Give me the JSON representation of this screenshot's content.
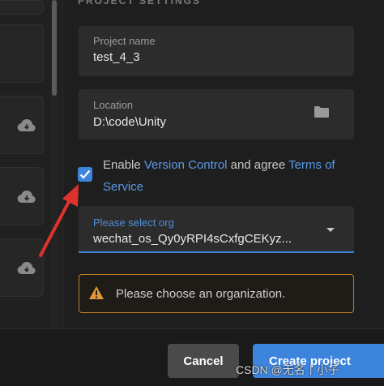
{
  "section": {
    "title": "PROJECT SETTINGS"
  },
  "project_name": {
    "label": "Project name",
    "value": "test_4_3"
  },
  "location": {
    "label": "Location",
    "value": "D:\\code\\Unity",
    "icon": "folder-icon"
  },
  "agreement": {
    "checked": true,
    "prefix": "Enable ",
    "link1": "Version Control",
    "middle": " and agree ",
    "link2": "Terms of Service"
  },
  "org": {
    "placeholder": "Please select org",
    "value": "wechat_os_Qy0yRPI4sCxfgCEKyz..."
  },
  "warning": {
    "message": "Please choose an organization.",
    "color": "#c27b2c"
  },
  "buttons": {
    "cancel": "Cancel",
    "create": "Create project"
  },
  "watermark": "CSDN @无名丨小子",
  "colors": {
    "accent": "#3d84dd",
    "annotation_arrow": "#e0322d"
  }
}
